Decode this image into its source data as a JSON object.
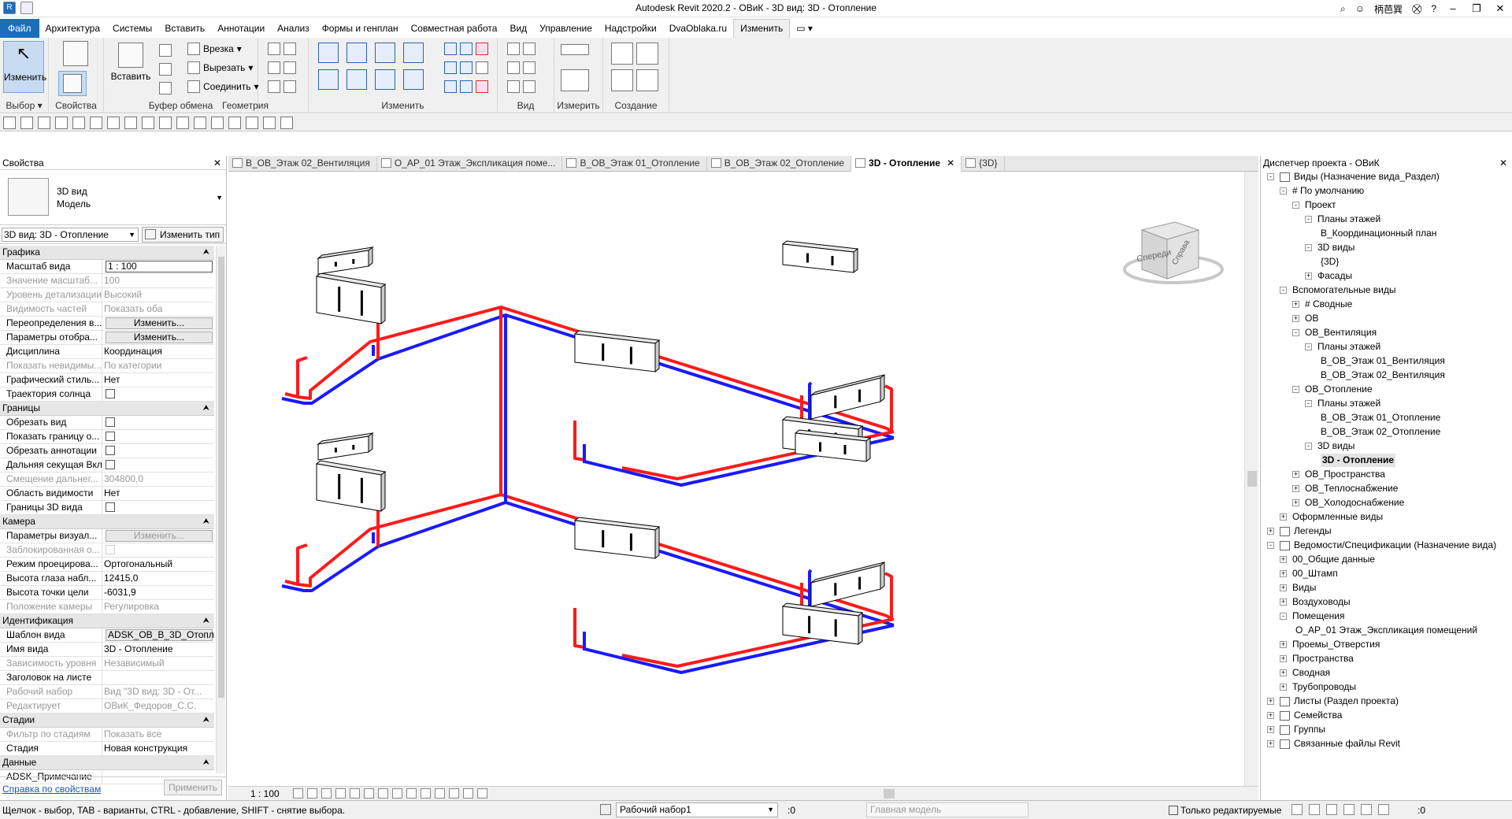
{
  "window": {
    "title": "Autodesk Revit 2020.2 - ОВиК - 3D вид: 3D - Отопление",
    "user": "柄芭巽",
    "controls": [
      "–",
      "❐",
      "✕"
    ]
  },
  "ribbon_tabs": [
    {
      "label": "Файл"
    },
    {
      "label": "Архитектура"
    },
    {
      "label": "Системы"
    },
    {
      "label": "Вставить"
    },
    {
      "label": "Аннотации"
    },
    {
      "label": "Анализ"
    },
    {
      "label": "Формы и генплан"
    },
    {
      "label": "Совместная работа"
    },
    {
      "label": "Вид"
    },
    {
      "label": "Управление"
    },
    {
      "label": "Надстройки"
    },
    {
      "label": "DvaOblaka.ru"
    },
    {
      "label": "Изменить"
    }
  ],
  "ribbon": {
    "select": {
      "button": "Изменить",
      "label": "Выбор ▾"
    },
    "properties": {
      "label": "Свойства"
    },
    "clipboard": {
      "paste": "Вставить",
      "label": "Буфер обмена"
    },
    "geometry": {
      "cut": "Врезка",
      "cutout": "Вырезать",
      "join": "Соединить",
      "label": "Геометрия"
    },
    "modify": {
      "label": "Изменить"
    },
    "view": {
      "label": "Вид"
    },
    "measure": {
      "label": "Измерить"
    },
    "create": {
      "label": "Создание"
    }
  },
  "properties": {
    "header": "Свойства",
    "type_name": "3D вид",
    "type_sub": "Модель",
    "view_selector": "3D вид: 3D - Отопление",
    "edit_type": "Изменить тип",
    "sections": [
      {
        "name": "Графика",
        "rows": [
          {
            "k": "Масштаб вида",
            "v": "1 : 100",
            "kind": "input"
          },
          {
            "k": "Значение масштаб...",
            "v": "100",
            "kind": "grey"
          },
          {
            "k": "Уровень детализации",
            "v": "Высокий",
            "kind": "grey"
          },
          {
            "k": "Видимость частей",
            "v": "Показать оба",
            "kind": "grey"
          },
          {
            "k": "Переопределения в...",
            "v": "Изменить...",
            "kind": "button"
          },
          {
            "k": "Параметры отобра...",
            "v": "Изменить...",
            "kind": "button"
          },
          {
            "k": "Дисциплина",
            "v": "Координация",
            "kind": "text"
          },
          {
            "k": "Показать невидимы...",
            "v": "По категории",
            "kind": "grey"
          },
          {
            "k": "Графический стиль...",
            "v": "Нет",
            "kind": "text"
          },
          {
            "k": "Траектория солнца",
            "v": "",
            "kind": "check"
          }
        ]
      },
      {
        "name": "Границы",
        "rows": [
          {
            "k": "Обрезать вид",
            "v": "",
            "kind": "check"
          },
          {
            "k": "Показать границу о...",
            "v": "",
            "kind": "check"
          },
          {
            "k": "Обрезать аннотации",
            "v": "",
            "kind": "check"
          },
          {
            "k": "Дальняя секущая Вкл",
            "v": "",
            "kind": "check"
          },
          {
            "k": "Смещение дальнег...",
            "v": "304800,0",
            "kind": "grey"
          },
          {
            "k": "Область видимости",
            "v": "Нет",
            "kind": "text"
          },
          {
            "k": "Границы 3D вида",
            "v": "",
            "kind": "check"
          }
        ]
      },
      {
        "name": "Камера",
        "rows": [
          {
            "k": "Параметры визуал...",
            "v": "Изменить...",
            "kind": "button-dis"
          },
          {
            "k": "Заблокированная о...",
            "v": "",
            "kind": "grey-check"
          },
          {
            "k": "Режим проецирова...",
            "v": "Ортогональный",
            "kind": "text"
          },
          {
            "k": "Высота глаза набл...",
            "v": "12415,0",
            "kind": "text"
          },
          {
            "k": "Высота точки цели",
            "v": "-6031,9",
            "kind": "text"
          },
          {
            "k": "Положение камеры",
            "v": "Регулировка",
            "kind": "grey"
          }
        ]
      },
      {
        "name": "Идентификация",
        "rows": [
          {
            "k": "Шаблон вида",
            "v": "ADSK_ОВ_В_3D_Отопл",
            "kind": "button-text"
          },
          {
            "k": "Имя вида",
            "v": "3D - Отопление",
            "kind": "text"
          },
          {
            "k": "Зависимость уровня",
            "v": "Независимый",
            "kind": "grey"
          },
          {
            "k": "Заголовок на листе",
            "v": "",
            "kind": "text"
          },
          {
            "k": "Рабочий набор",
            "v": "Вид \"3D вид: 3D - От...",
            "kind": "grey"
          },
          {
            "k": "Редактирует",
            "v": "ОВиК_Федоров_С.С.",
            "kind": "grey"
          }
        ]
      },
      {
        "name": "Стадии",
        "rows": [
          {
            "k": "Фильтр по стадиям",
            "v": "Показать все",
            "kind": "grey"
          },
          {
            "k": "Стадия",
            "v": "Новая конструкция",
            "kind": "text"
          }
        ]
      },
      {
        "name": "Данные",
        "rows": [
          {
            "k": "ADSK_Примечание",
            "v": "",
            "kind": "text"
          }
        ]
      }
    ],
    "help_link": "Справка по свойствам",
    "apply": "Применить"
  },
  "doc_tabs": [
    {
      "label": "В_ОВ_Этаж 02_Вентиляция",
      "active": false
    },
    {
      "label": "О_АР_01 Этаж_Экспликация поме...",
      "active": false
    },
    {
      "label": "В_ОВ_Этаж 01_Отопление",
      "active": false
    },
    {
      "label": "В_ОВ_Этаж 02_Отопление",
      "active": false
    },
    {
      "label": "3D - Отопление",
      "active": true
    },
    {
      "label": "{3D}",
      "active": false
    }
  ],
  "viewcube": {
    "front": "Спереди",
    "right": "Справа"
  },
  "viewbar": {
    "scale": "1 : 100"
  },
  "browser": {
    "header": "Диспетчер проекта - ОВиК",
    "items": [
      {
        "label": "Виды (Назначение вида_Раздел)",
        "level": 0,
        "exp": "-",
        "icon": true
      },
      {
        "label": "# По умолчанию",
        "level": 1,
        "exp": "-"
      },
      {
        "label": "Проект",
        "level": 2,
        "exp": "-"
      },
      {
        "label": "Планы этажей",
        "level": 3,
        "exp": "-"
      },
      {
        "label": "В_Координационный план",
        "level": 4,
        "exp": ""
      },
      {
        "label": "3D виды",
        "level": 3,
        "exp": "-"
      },
      {
        "label": "{3D}",
        "level": 4,
        "exp": ""
      },
      {
        "label": "Фасады",
        "level": 3,
        "exp": "+"
      },
      {
        "label": "Вспомогательные виды",
        "level": 1,
        "exp": "-"
      },
      {
        "label": "# Сводные",
        "level": 2,
        "exp": "+"
      },
      {
        "label": "ОВ",
        "level": 2,
        "exp": "+"
      },
      {
        "label": "ОВ_Вентиляция",
        "level": 2,
        "exp": "-"
      },
      {
        "label": "Планы этажей",
        "level": 3,
        "exp": "-"
      },
      {
        "label": "В_ОВ_Этаж 01_Вентиляция",
        "level": 4,
        "exp": ""
      },
      {
        "label": "В_ОВ_Этаж 02_Вентиляция",
        "level": 4,
        "exp": ""
      },
      {
        "label": "ОВ_Отопление",
        "level": 2,
        "exp": "-"
      },
      {
        "label": "Планы этажей",
        "level": 3,
        "exp": "-"
      },
      {
        "label": "В_ОВ_Этаж 01_Отопление",
        "level": 4,
        "exp": ""
      },
      {
        "label": "В_ОВ_Этаж 02_Отопление",
        "level": 4,
        "exp": ""
      },
      {
        "label": "3D виды",
        "level": 3,
        "exp": "-"
      },
      {
        "label": "3D - Отопление",
        "level": 4,
        "exp": "",
        "bold": true
      },
      {
        "label": "ОВ_Пространства",
        "level": 2,
        "exp": "+"
      },
      {
        "label": "ОВ_Теплоснабжение",
        "level": 2,
        "exp": "+"
      },
      {
        "label": "ОВ_Холодоснабжение",
        "level": 2,
        "exp": "+"
      },
      {
        "label": "Оформленные виды",
        "level": 1,
        "exp": "+"
      },
      {
        "label": "Легенды",
        "level": 0,
        "exp": "+",
        "icon": true
      },
      {
        "label": "Ведомости/Спецификации (Назначение вида)",
        "level": 0,
        "exp": "-",
        "icon": true
      },
      {
        "label": "00_Общие данные",
        "level": 1,
        "exp": "+"
      },
      {
        "label": "00_Штамп",
        "level": 1,
        "exp": "+"
      },
      {
        "label": "Виды",
        "level": 1,
        "exp": "+"
      },
      {
        "label": "Воздуховоды",
        "level": 1,
        "exp": "+"
      },
      {
        "label": "Помещения",
        "level": 1,
        "exp": "-"
      },
      {
        "label": "О_АР_01 Этаж_Экспликация помещений",
        "level": 2,
        "exp": ""
      },
      {
        "label": "Проемы_Отверстия",
        "level": 1,
        "exp": "+"
      },
      {
        "label": "Пространства",
        "level": 1,
        "exp": "+"
      },
      {
        "label": "Сводная",
        "level": 1,
        "exp": "+"
      },
      {
        "label": "Трубопроводы",
        "level": 1,
        "exp": "+"
      },
      {
        "label": "Листы (Раздел проекта)",
        "level": 0,
        "exp": "+",
        "icon": true
      },
      {
        "label": "Семейства",
        "level": 0,
        "exp": "+",
        "icon": true
      },
      {
        "label": "Группы",
        "level": 0,
        "exp": "+",
        "icon": true
      },
      {
        "label": "Связанные файлы Revit",
        "level": 0,
        "exp": "+",
        "icon": true
      }
    ]
  },
  "status": {
    "message": "Щелчок - выбор, TAB - варианты, CTRL - добавление, SHIFT - снятие выбора.",
    "workset": "Рабочий набор1",
    "zero1": ":0",
    "model": "Главная модель",
    "editable_only": "Только редактируемые",
    "zero2": ":0"
  },
  "colors": {
    "supply": "#ff1a1a",
    "return": "#1a1aff",
    "accent": "#1c6ebd"
  }
}
